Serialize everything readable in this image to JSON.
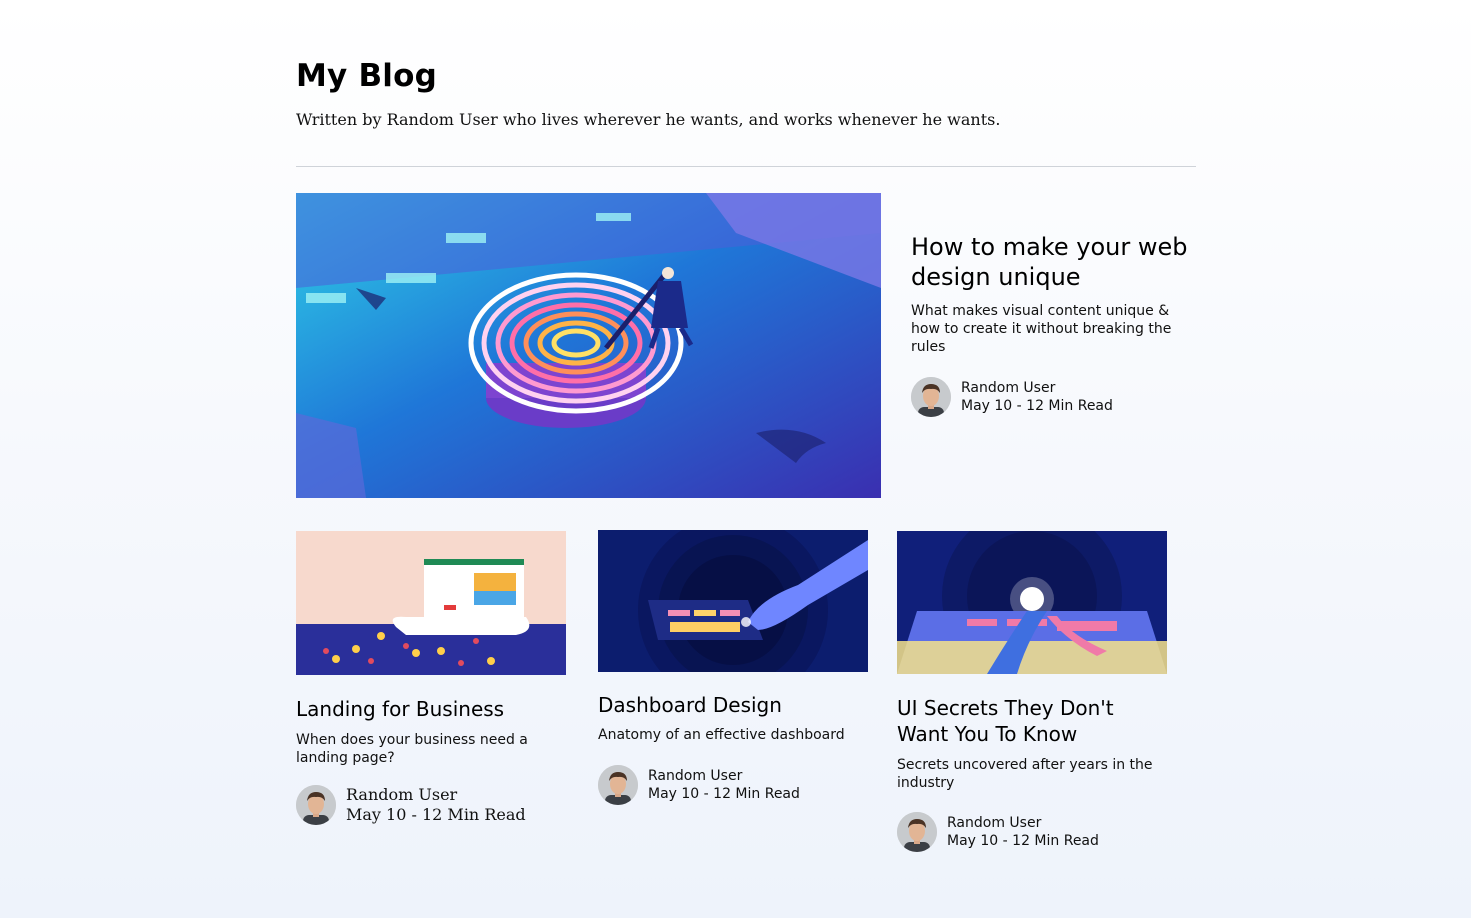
{
  "header": {
    "title": "My Blog",
    "subtitle": "Written by Random User who lives wherever he wants, and works whenever he wants."
  },
  "featured": {
    "title": "How to make your web design unique",
    "description": "What makes visual content unique & how to create it without breaking the rules",
    "author": "Random User",
    "meta": "May 10 - 12 Min Read",
    "image": "fingerprint-pool-illustration"
  },
  "posts": [
    {
      "title": "Landing for Business",
      "description": "When does your business need a landing page?",
      "author": "Random User",
      "meta": "May 10 - 12 Min Read",
      "image": "landing-page-crowd-illustration"
    },
    {
      "title": "Dashboard Design",
      "description": "Anatomy of an effective dashboard",
      "author": "Random User",
      "meta": "May 10 - 12 Min Read",
      "image": "hand-touching-tablet-illustration"
    },
    {
      "title": "UI Secrets They Don't Want You To Know",
      "description": "Secrets uncovered after years in the industry",
      "author": "Random User",
      "meta": "May 10 - 12 Min Read",
      "image": "ui-landscape-illustration"
    }
  ],
  "colors": {
    "text": "#000000",
    "rule": "#cfd3d9",
    "background_bottom": "#eef3fb"
  }
}
